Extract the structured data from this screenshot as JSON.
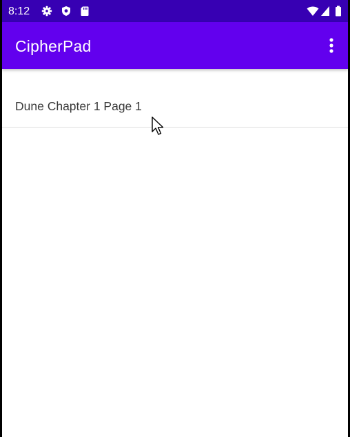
{
  "status_bar": {
    "time": "8:12",
    "left_icons": [
      "gear-icon",
      "shield-icon",
      "sd-card-icon"
    ],
    "right_icons": [
      "wifi-icon",
      "cell-signal-icon",
      "battery-icon"
    ],
    "background": "#3700b3"
  },
  "app_bar": {
    "title": "CipherPad",
    "background": "#6200ee",
    "overflow_icon": "more-vert-icon"
  },
  "list": {
    "items": [
      {
        "label": "Dune Chapter 1 Page 1"
      }
    ]
  }
}
